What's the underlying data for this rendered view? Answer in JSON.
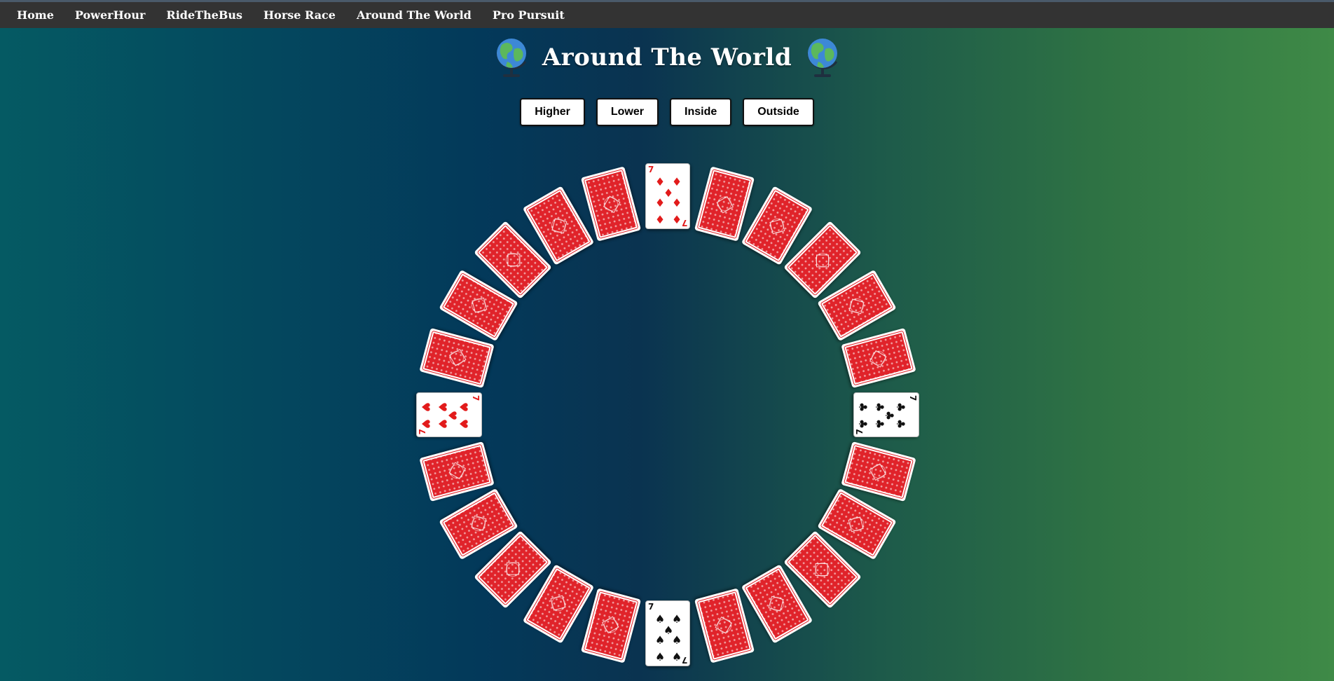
{
  "nav": {
    "items": [
      {
        "label": "Home"
      },
      {
        "label": "PowerHour"
      },
      {
        "label": "RideTheBus"
      },
      {
        "label": "Horse Race"
      },
      {
        "label": "Around The World"
      },
      {
        "label": "Pro Pursuit"
      }
    ]
  },
  "header": {
    "title": "Around The World",
    "left_icon": "globe-icon",
    "right_icon": "globe-icon"
  },
  "guesses": {
    "higher": "Higher",
    "lower": "Lower",
    "inside": "Inside",
    "outside": "Outside"
  },
  "table": {
    "face_up": [
      {
        "position": "top",
        "rank": "7",
        "suit": "diamonds",
        "symbol": "♦",
        "color": "#e21b1b"
      },
      {
        "position": "left",
        "rank": "7",
        "suit": "hearts",
        "symbol": "♥",
        "color": "#e21b1b"
      },
      {
        "position": "right",
        "rank": "7",
        "suit": "clubs",
        "symbol": "♣",
        "color": "#111111"
      },
      {
        "position": "bottom",
        "rank": "7",
        "suit": "spades",
        "symbol": "♠",
        "color": "#111111"
      }
    ],
    "face_down_count": 20,
    "card_back_color": "#e0232a"
  },
  "colors": {
    "nav_bg": "#333333",
    "bg_left": "#055a63",
    "bg_mid": "#03395a",
    "bg_right": "#3f8a47"
  }
}
